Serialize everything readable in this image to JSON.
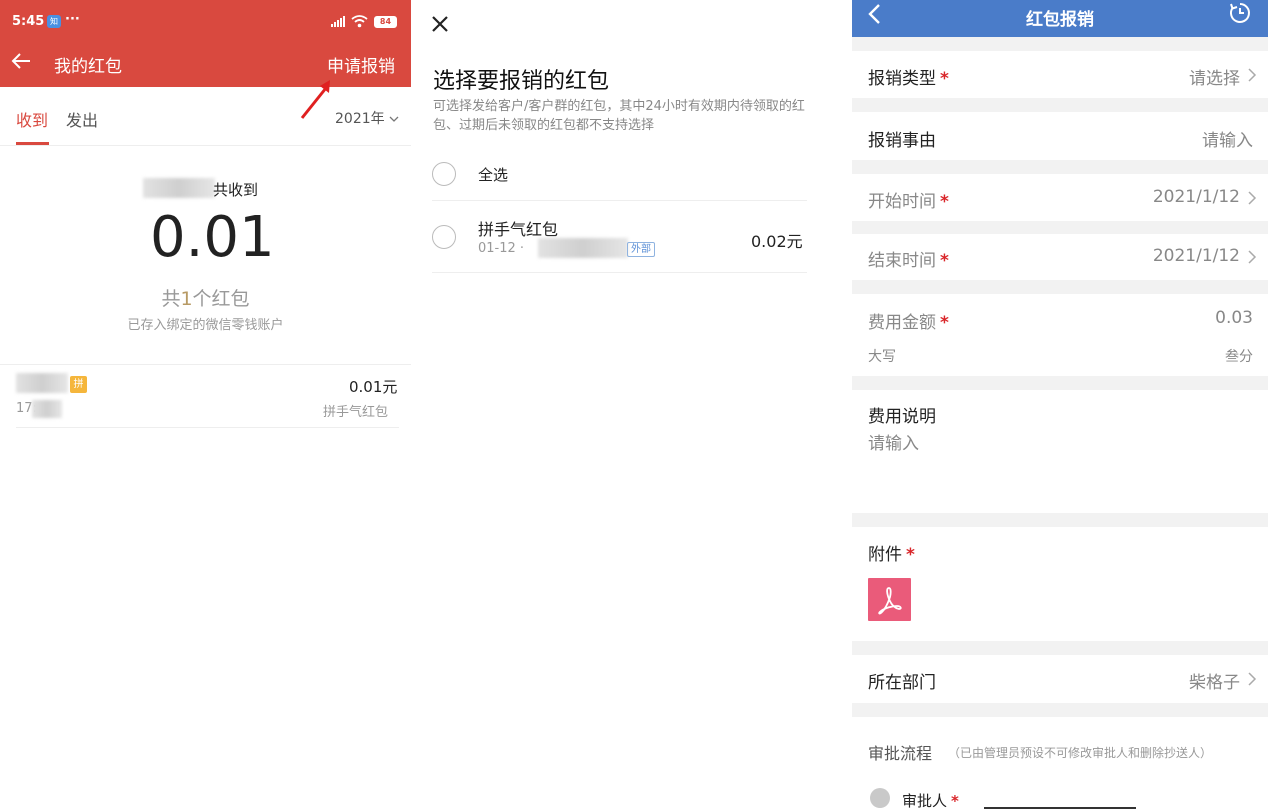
{
  "panel1": {
    "status": {
      "time": "5:45",
      "dots": "···",
      "battery": "84"
    },
    "header": {
      "title": "我的红包",
      "apply_label": "申请报销"
    },
    "tabs": {
      "received": "收到",
      "sent": "发出",
      "year": "2021年"
    },
    "summary": {
      "received_suffix": "共收到",
      "amount": "0.01",
      "count_prefix": "共",
      "count_num": "1",
      "count_suffix": "个红包",
      "note": "已存入绑定的微信零钱账户"
    },
    "items": [
      {
        "tag": "拼",
        "time_prefix": "17:",
        "amount": "0.01元",
        "type": "拼手气红包"
      }
    ],
    "colors": {
      "header_bg": "#d9493f",
      "accent": "#d9493f"
    }
  },
  "panel2": {
    "title": "选择要报销的红包",
    "description": "可选择发给客户/客户群的红包，其中24小时有效期内待领取的红包、过期后未领取的红包都不支持选择",
    "select_all": "全选",
    "item": {
      "title": "拼手气红包",
      "date": "01-12 ·",
      "tag": "外部",
      "amount": "0.02元"
    }
  },
  "panel3": {
    "title": "红包报销",
    "fields": {
      "type": {
        "label": "报销类型",
        "value": "请选择"
      },
      "reason": {
        "label": "报销事由",
        "value": "请输入"
      },
      "start": {
        "label": "开始时间",
        "value": "2021/1/12"
      },
      "end": {
        "label": "结束时间",
        "value": "2021/1/12"
      },
      "amount": {
        "label": "费用金额",
        "value": "0.03",
        "caps_label": "大写",
        "caps_value": "叁分"
      },
      "desc": {
        "label": "费用说明",
        "placeholder": "请输入"
      },
      "attach": {
        "label": "附件"
      },
      "dept": {
        "label": "所在部门",
        "value": "柴格子"
      },
      "flow": {
        "label": "审批流程",
        "note": "（已由管理员预设不可修改审批人和删除抄送人）"
      },
      "approver": {
        "label": "审批人"
      }
    },
    "required_mark": "*",
    "colors": {
      "header_bg": "#4a7cc9",
      "required": "#d9262a",
      "pdf_bg": "#ea5b7a"
    }
  }
}
